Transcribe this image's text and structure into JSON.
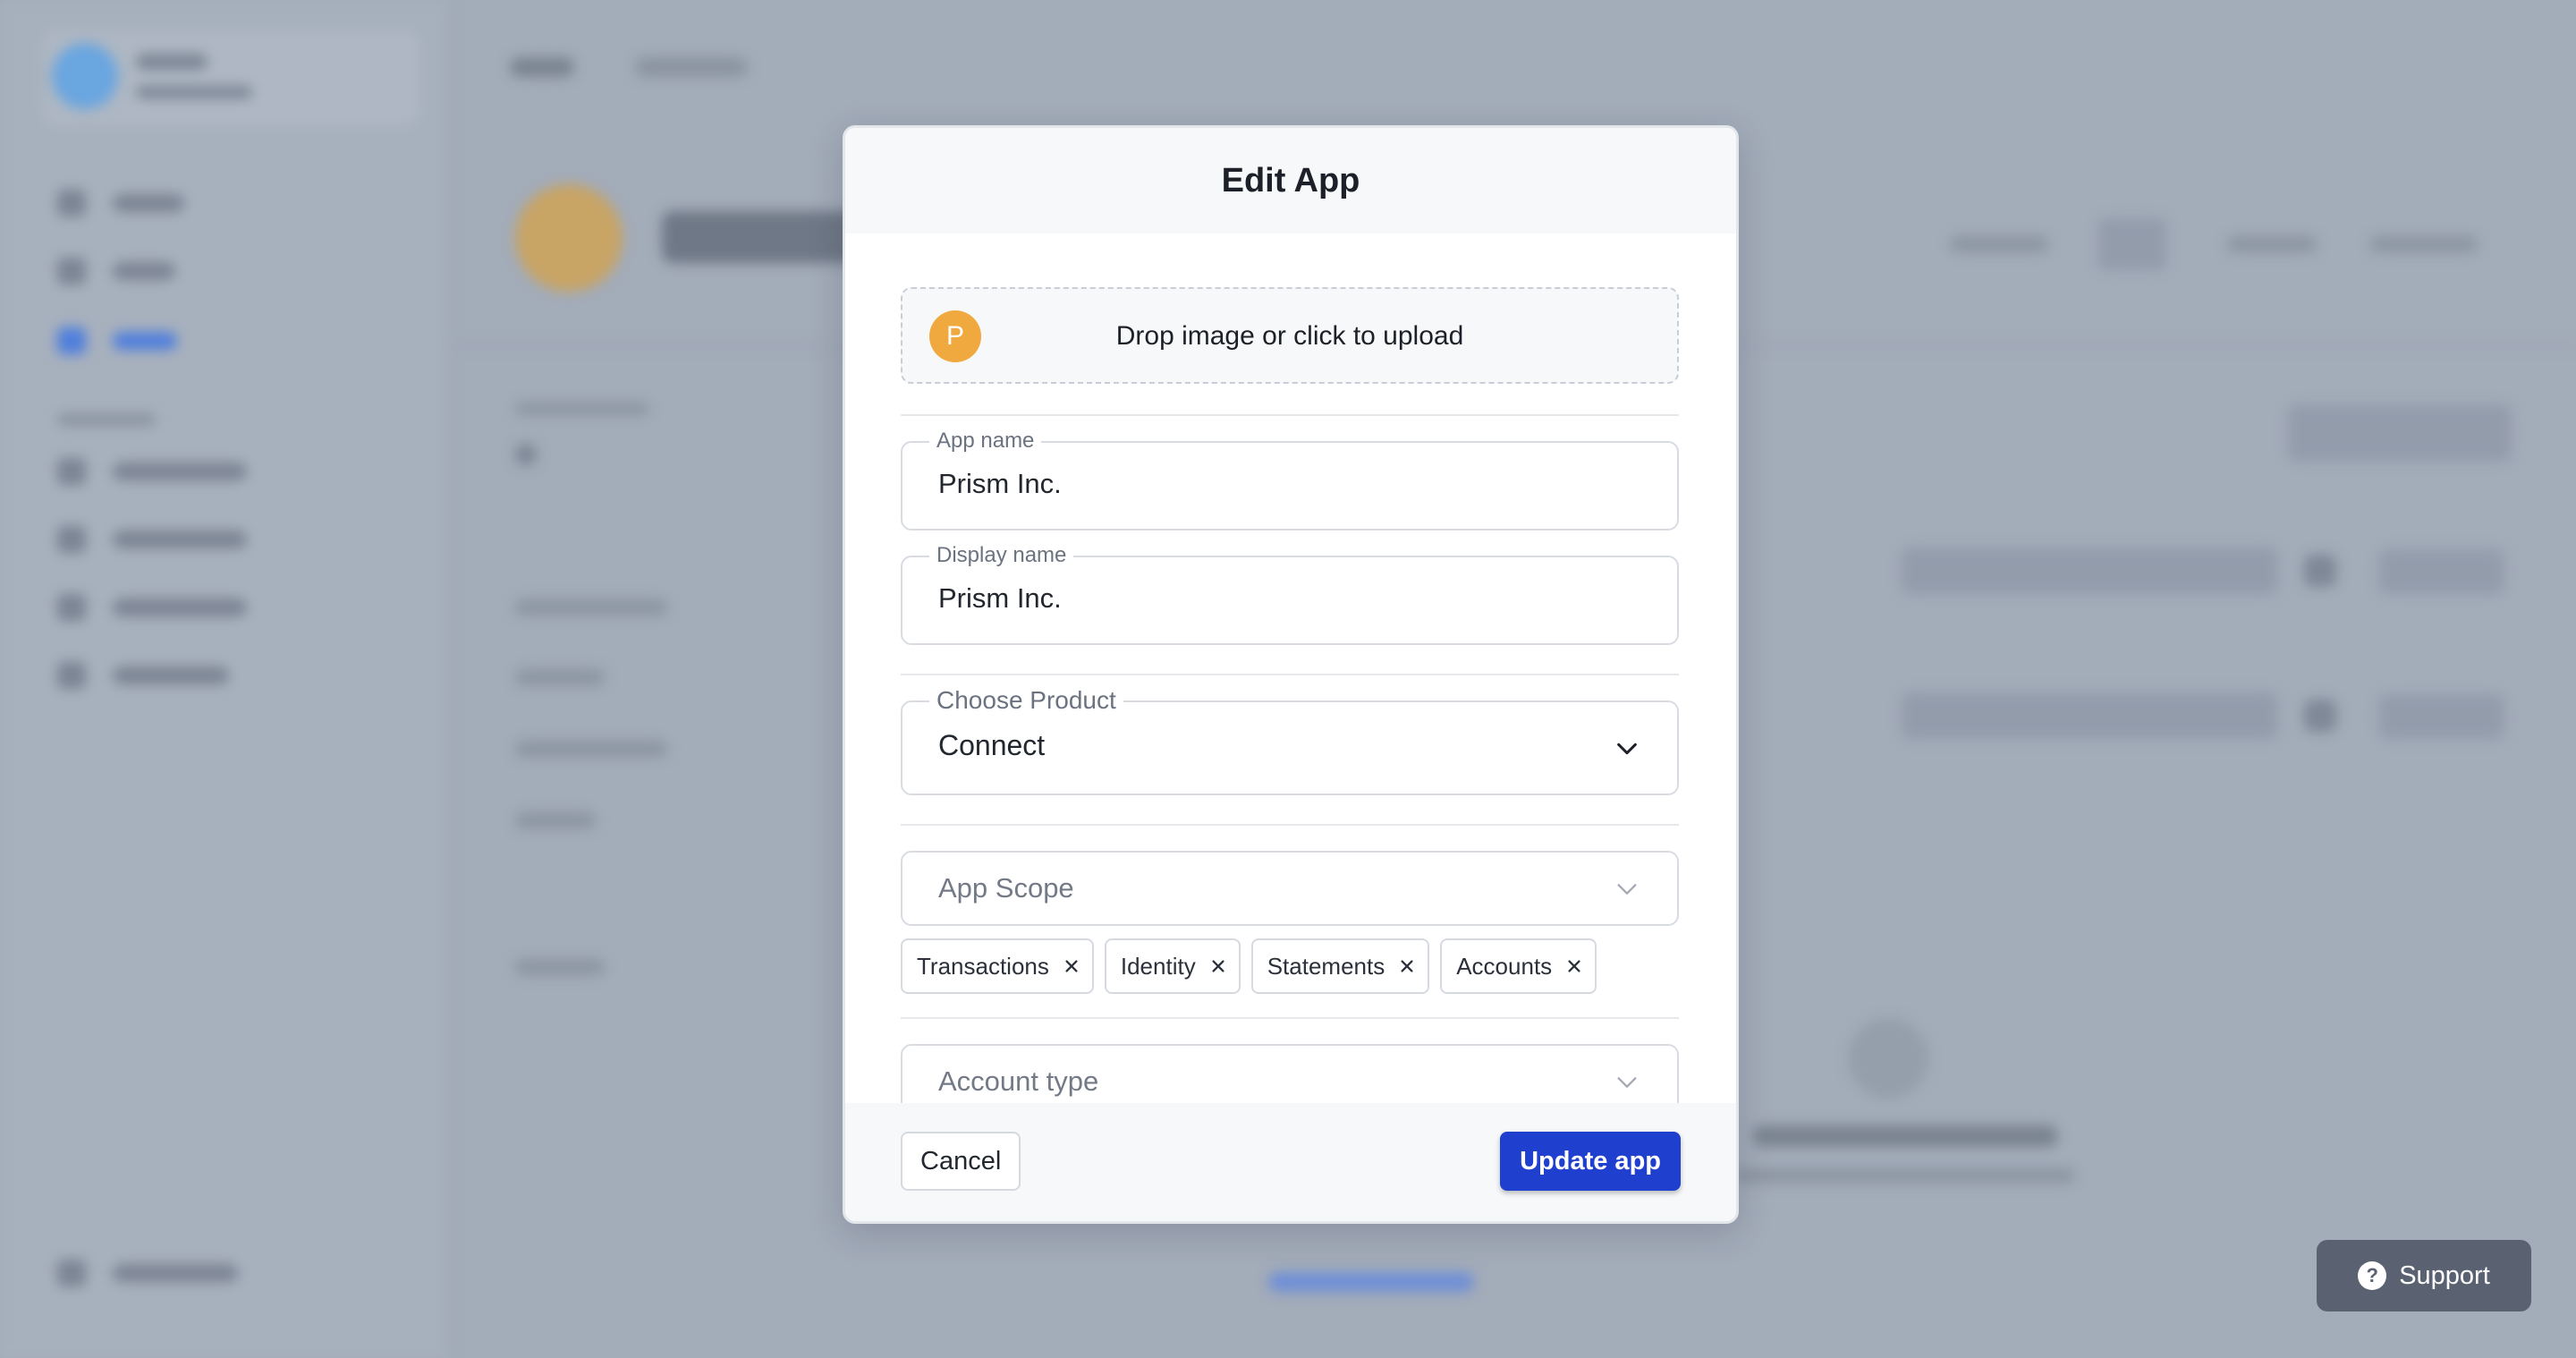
{
  "modal": {
    "title": "Edit App",
    "upload": {
      "avatar_letter": "P",
      "text": "Drop image or click to upload"
    },
    "app_name": {
      "label": "App name",
      "value": "Prism Inc."
    },
    "display_name": {
      "label": "Display name",
      "value": "Prism Inc."
    },
    "product": {
      "label": "Choose Product",
      "value": "Connect"
    },
    "app_scope": {
      "placeholder": "App Scope",
      "chips": [
        "Transactions",
        "Identity",
        "Statements",
        "Accounts"
      ]
    },
    "account_type": {
      "placeholder": "Account type"
    },
    "cancel_label": "Cancel",
    "submit_label": "Update app"
  },
  "support": {
    "label": "Support",
    "icon": "question-circle-icon"
  },
  "colors": {
    "primary": "#1f3fcf",
    "upload_avatar": "#f0a93f",
    "support_bg": "#5a6272"
  }
}
